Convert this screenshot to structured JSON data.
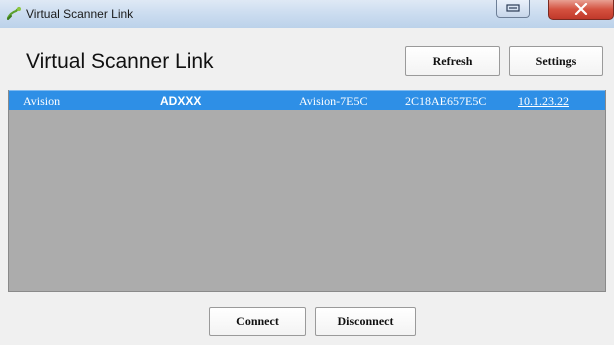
{
  "window": {
    "title": "Virtual Scanner Link",
    "icon": "app-link-icon",
    "controls": {
      "restore": "restore-icon",
      "close": "close-icon"
    }
  },
  "header": {
    "title": "Virtual Scanner Link",
    "refresh_label": "Refresh",
    "settings_label": "Settings"
  },
  "devices": [
    {
      "vendor": "Avision",
      "model": "ADXXX",
      "name": "Avision-7E5C",
      "mac": "2C18AE657E5C",
      "ip": "10.1.23.22"
    }
  ],
  "footer": {
    "connect_label": "Connect",
    "disconnect_label": "Disconnect"
  },
  "colors": {
    "selected_row": "#2e8fe6",
    "list_background": "#acacac",
    "window_background": "#f0f0f0",
    "close_button": "#c0392b"
  }
}
